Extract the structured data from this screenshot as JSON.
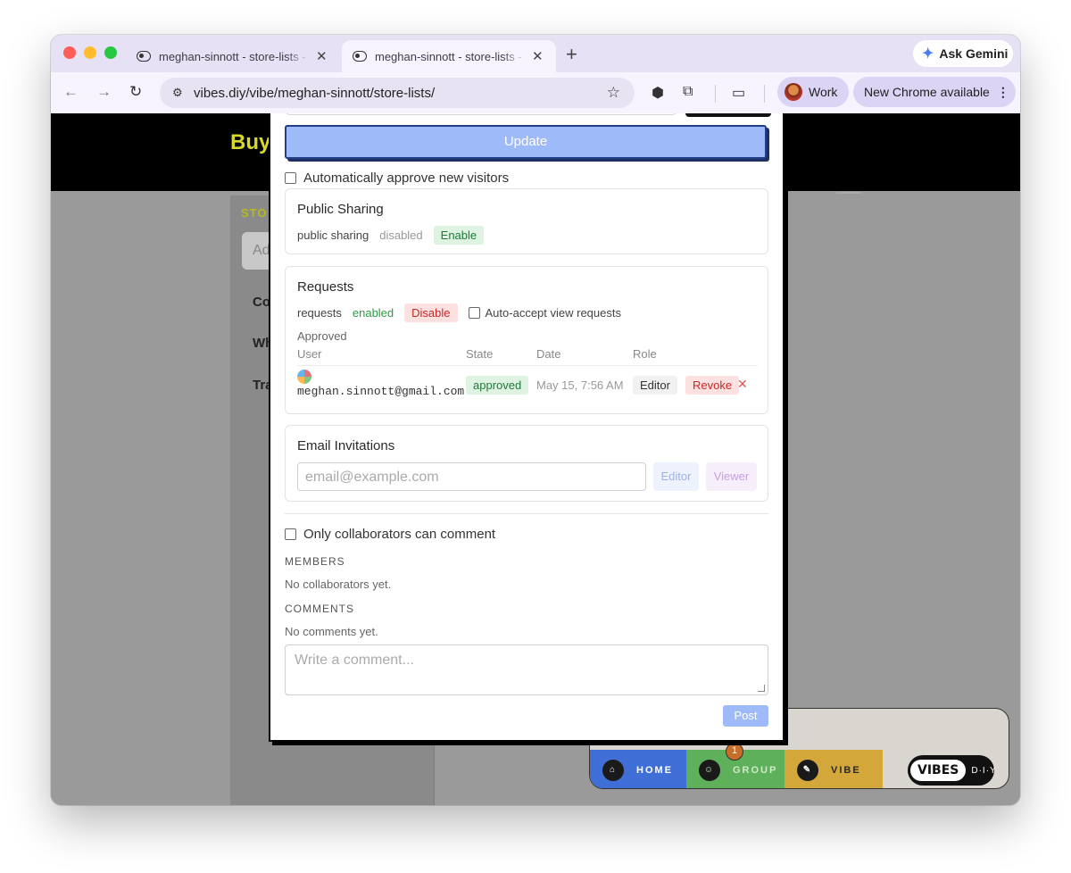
{
  "browser": {
    "tabs": [
      {
        "title": "meghan-sinnott - store-lists -"
      },
      {
        "title": "meghan-sinnott - store-lists -"
      }
    ],
    "new_tab": "+",
    "ask_gemini": "Ask Gemini",
    "url": "vibes.diy/vibe/meghan-sinnott/store-lists/",
    "profile": "Work",
    "update_notice": "New Chrome available"
  },
  "page": {
    "header_text": "Buy",
    "sidebar_heading": "STO",
    "add_placeholder": "Ad",
    "sidebar_items": [
      "Co",
      "Wh",
      "Tra"
    ]
  },
  "modal": {
    "update_button": "Update",
    "auto_approve_label": "Automatically approve new visitors",
    "public_sharing": {
      "title": "Public Sharing",
      "label": "public sharing",
      "status": "disabled",
      "action": "Enable"
    },
    "requests": {
      "title": "Requests",
      "label": "requests",
      "status": "enabled",
      "action": "Disable",
      "auto_accept_label": "Auto-accept view requests",
      "approved_heading": "Approved",
      "columns": [
        "User",
        "State",
        "Date",
        "Role"
      ],
      "rows": [
        {
          "email": "meghan.sinnott@gmail.com",
          "state": "approved",
          "date": "May 15, 7:56 AM",
          "role": "Editor",
          "revoke": "Revoke",
          "remove": "✕"
        }
      ]
    },
    "email_invitations": {
      "title": "Email Invitations",
      "placeholder": "email@example.com",
      "editor_button": "Editor",
      "viewer_button": "Viewer"
    },
    "only_collaborators_label": "Only collaborators can comment",
    "members_heading": "MEMBERS",
    "members_empty": "No collaborators yet.",
    "comments_heading": "COMMENTS",
    "comments_empty": "No comments yet.",
    "comment_placeholder": "Write a comment...",
    "post_button": "Post"
  },
  "vibes_bar": {
    "home": "HOME",
    "group": "GROUP",
    "vibe": "VIBE",
    "badge_count": "1",
    "logo_word": "VIBES",
    "logo_suffix": "D·I·Y",
    "colors": {
      "home": "#3f6fd6",
      "group": "#5fb05a",
      "vibe": "#d3a73a"
    }
  }
}
